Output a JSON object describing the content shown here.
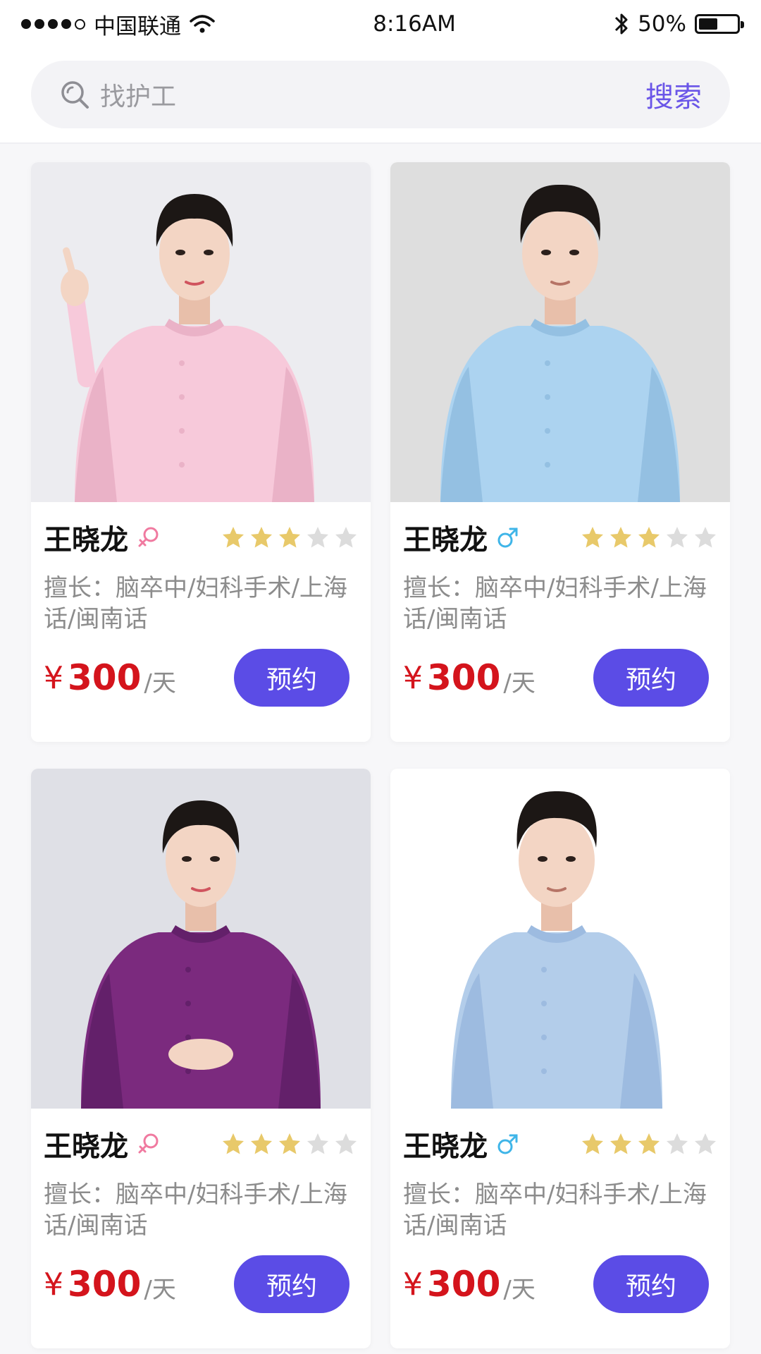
{
  "status_bar": {
    "carrier": "中国联通",
    "time": "8:16AM",
    "battery_text": "50%",
    "battery_level": 0.5
  },
  "search": {
    "placeholder": "找护工",
    "button_label": "搜索"
  },
  "colors": {
    "accent": "#5b4ce6",
    "price": "#d4141c",
    "female": "#f07aa0",
    "male": "#3fb5e8",
    "star_on": "#e8c96a",
    "star_off": "#dcdcdc"
  },
  "caregivers": [
    {
      "name": "王晓龙",
      "gender_icon": "female-icon",
      "rating": 3,
      "max_rating": 5,
      "skills": "擅长：脑卒中/妇科手术/上海话/闽南话",
      "currency": "¥",
      "price": "300",
      "unit": "/天",
      "book_label": "预约",
      "photo": "female-caregiver-pink-uniform"
    },
    {
      "name": "王晓龙",
      "gender_icon": "male-icon",
      "rating": 3,
      "max_rating": 5,
      "skills": "擅长：脑卒中/妇科手术/上海话/闽南话",
      "currency": "¥",
      "price": "300",
      "unit": "/天",
      "book_label": "预约",
      "photo": "male-caregiver-blue-uniform"
    },
    {
      "name": "王晓龙",
      "gender_icon": "female-icon",
      "rating": 3,
      "max_rating": 5,
      "skills": "擅长：脑卒中/妇科手术/上海话/闽南话",
      "currency": "¥",
      "price": "300",
      "unit": "/天",
      "book_label": "预约",
      "photo": "female-caregiver-purple-uniform"
    },
    {
      "name": "王晓龙",
      "gender_icon": "male-icon",
      "rating": 3,
      "max_rating": 5,
      "skills": "擅长：脑卒中/妇科手术/上海话/闽南话",
      "currency": "¥",
      "price": "300",
      "unit": "/天",
      "book_label": "预约",
      "photo": "male-caregiver-lightblue-longsleeve"
    }
  ]
}
